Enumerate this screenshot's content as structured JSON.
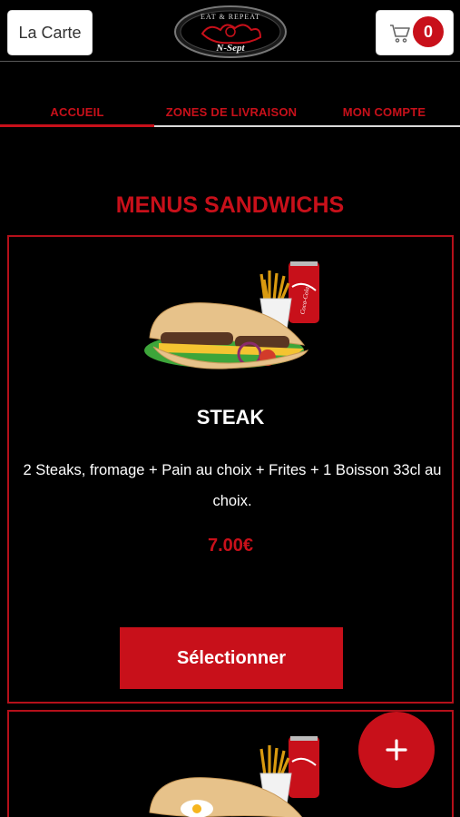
{
  "header": {
    "menu_label": "La Carte",
    "logo_top_text": "EAT & REPEAT",
    "logo_bottom_text": "N-Sept",
    "cart_count": "0"
  },
  "nav": {
    "tabs": [
      {
        "label": "ACCUEIL",
        "active": true
      },
      {
        "label": "ZONES DE LIVRAISON",
        "active": false
      },
      {
        "label": "MON COMPTE",
        "active": false
      }
    ]
  },
  "section": {
    "title": "MENUS SANDWICHS"
  },
  "products": [
    {
      "name": "STEAK",
      "description": "2 Steaks, fromage + Pain au choix + Frites + 1 Boisson 33cl au choix.",
      "price": "7.00€",
      "button_label": "Sélectionner",
      "image_icon": "sandwich-fries-soda-image"
    },
    {
      "image_icon": "sandwich-egg-fries-soda-image"
    }
  ],
  "fab": {
    "label": "+"
  },
  "colors": {
    "accent": "#c8101a",
    "background": "#000000",
    "tab_divider": "#d8d8d8"
  }
}
